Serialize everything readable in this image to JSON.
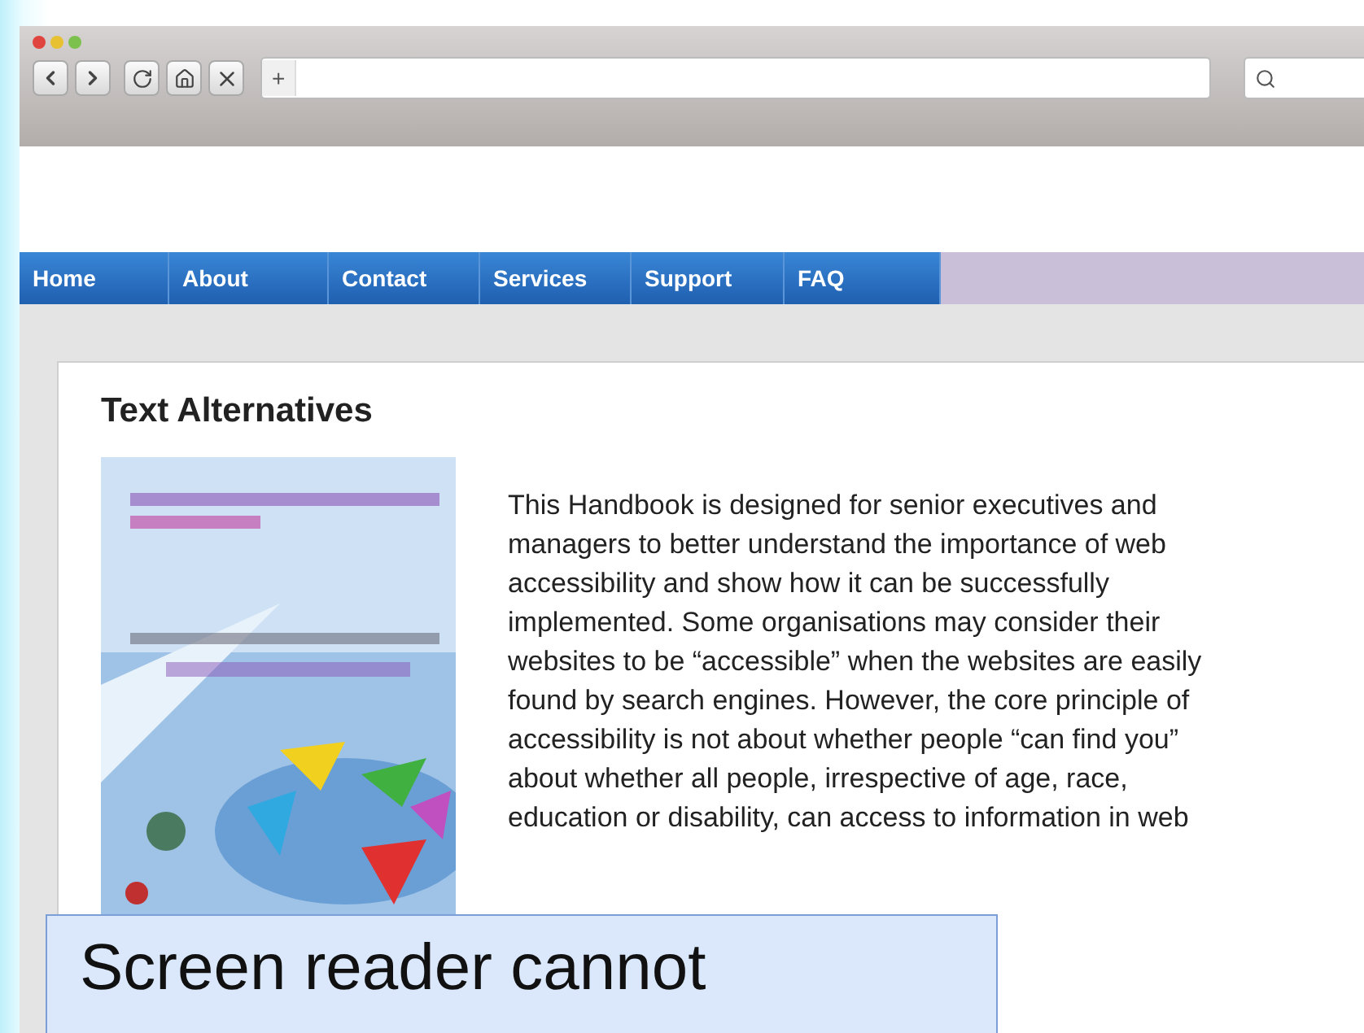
{
  "browser": {
    "new_tab_label": "+"
  },
  "nav": [
    {
      "label": "Home"
    },
    {
      "label": "About"
    },
    {
      "label": "Contact"
    },
    {
      "label": "Services"
    },
    {
      "label": "Support"
    },
    {
      "label": "FAQ"
    }
  ],
  "article": {
    "heading": "Text Alternatives",
    "text": "This Handbook is designed for senior executives and\nmanagers to better understand the importance of web\naccessibility and show how it can be successfully\nimplemented. Some organisations may consider their\nwebsites to be “accessible” when the websites are easily\nfound by search engines. However, the core principle of\naccessibility is not about whether people “can find you”\nabout whether all people, irrespective of age, race,\neducation or disability, can access to information in web"
  },
  "caption": "Screen reader cannot"
}
